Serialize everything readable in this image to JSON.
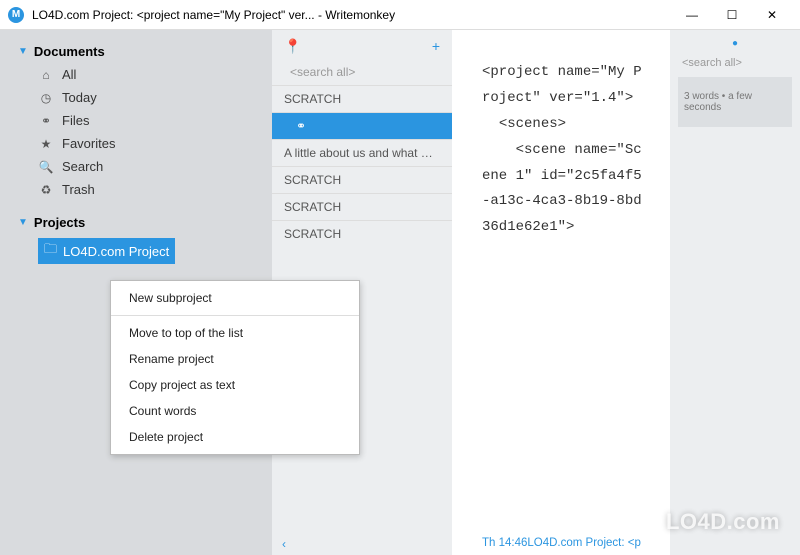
{
  "window": {
    "title": "LO4D.com Project:  <project name=\"My Project\" ver... - Writemonkey",
    "app_icon_letter": "M"
  },
  "sidebar": {
    "documents": {
      "label": "Documents",
      "items": [
        {
          "icon": "⌂",
          "label": "All"
        },
        {
          "icon": "◷",
          "label": "Today"
        },
        {
          "icon": "⚭",
          "label": "Files"
        },
        {
          "icon": "★",
          "label": "Favorites"
        },
        {
          "icon": "🔍",
          "label": "Search"
        },
        {
          "icon": "♻",
          "label": "Trash"
        }
      ]
    },
    "projects": {
      "label": "Projects",
      "items": [
        {
          "icon": "🗀",
          "label": "LO4D.com Project"
        }
      ]
    }
  },
  "midpanel": {
    "pin_icon": "📍",
    "plus_icon": "+",
    "search_placeholder": "<search all>",
    "items": [
      {
        "label": "SCRATCH",
        "selected": false
      },
      {
        "label": "⚭",
        "selected": true,
        "sub": true
      },
      {
        "label": "A little about us and what we …",
        "selected": false
      },
      {
        "label": "SCRATCH",
        "selected": false
      },
      {
        "label": "SCRATCH",
        "selected": false
      },
      {
        "label": "SCRATCH",
        "selected": false
      }
    ],
    "footer_icon": "‹"
  },
  "editor": {
    "content": "<project name=\"My Project\" ver=\"1.4\">\n  <scenes>\n    <scene name=\"Scene 1\" id=\"2c5fa4f5-a13c-4ca3-8b19-8bd36d1e62e1\">",
    "footer": "Th 14:46LO4D.com Project:  <p"
  },
  "rightpanel": {
    "search_placeholder": "<search all>",
    "info": "3 words  •  a few seconds"
  },
  "context_menu": {
    "items": [
      "New subproject",
      "-",
      "Move to top of the list",
      "Rename project",
      "Copy project as text",
      "Count words",
      "Delete project"
    ]
  },
  "watermark": "LO4D.com"
}
